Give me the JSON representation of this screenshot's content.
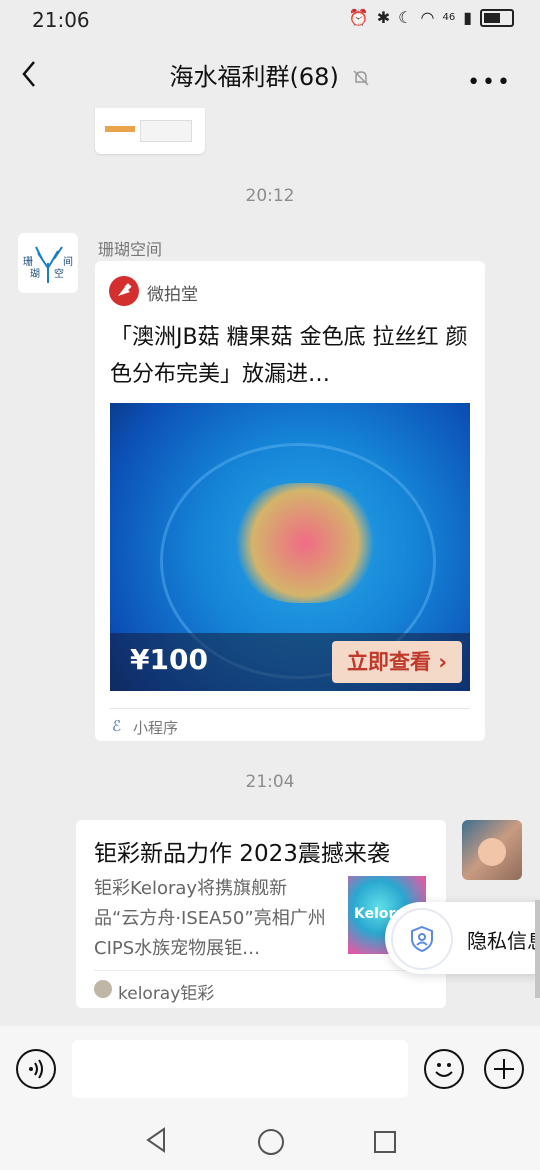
{
  "status_bar": {
    "time": "21:06",
    "icons": [
      "alarm-icon",
      "bluetooth-icon",
      "moon-icon",
      "wifi-icon",
      "signal-icon",
      "battery-icon"
    ],
    "network_badge": "46"
  },
  "header": {
    "title": "海水福利群(68)",
    "more": "•••"
  },
  "messages": {
    "timestamp1": "20:12",
    "sender1": "珊瑚空间",
    "avatar1_text": "珊 间\n瑚 空",
    "card1": {
      "brand": "微拍堂",
      "title": "「澳洲JB菇 糖果菇 金色底 拉丝红 颜色分布完美」放漏进…",
      "price": "¥100",
      "cta": "立即查看",
      "footer": "小程序"
    },
    "timestamp2": "21:04",
    "card2": {
      "title": "钜彩新品力作 2023震撼来袭",
      "desc": "钜彩Keloray将携旗舰新品“云方舟·ISEA50”亮相广州CIPS水族宠物展钜…",
      "thumb_text": "Keloray",
      "source": "keloray钜彩"
    }
  },
  "privacy_toast": {
    "label": "隐私信息"
  },
  "input_bar": {
    "voice": "◉",
    "emoji": "☺",
    "plus": "+"
  }
}
